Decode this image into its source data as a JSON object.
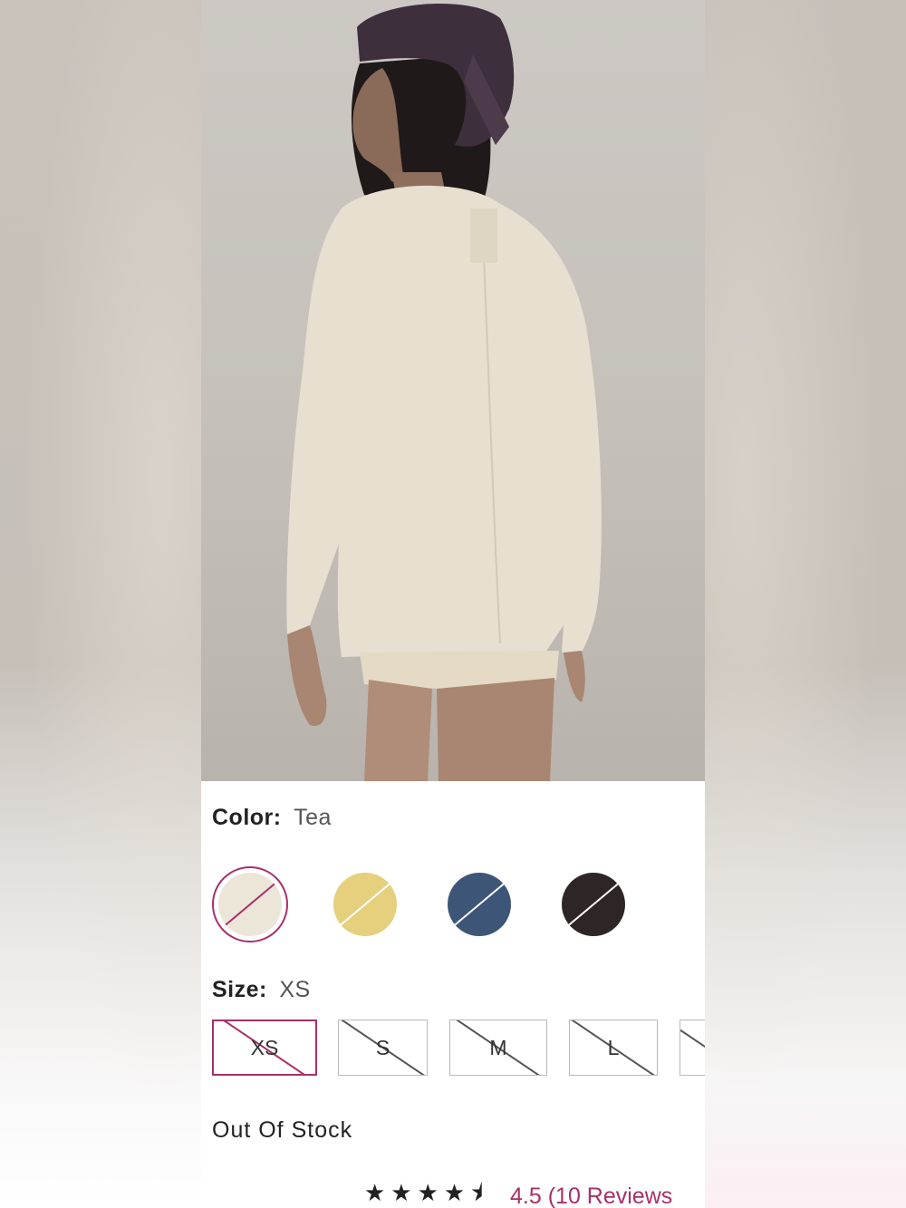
{
  "product": {
    "color": {
      "label": "Color:",
      "selected": "Tea",
      "swatches": [
        {
          "name": "tea",
          "hex": "#ece6d9",
          "selected": true,
          "available": false
        },
        {
          "name": "yellow",
          "hex": "#e6d07e",
          "selected": false,
          "available": false
        },
        {
          "name": "navy",
          "hex": "#3d5677",
          "selected": false,
          "available": false
        },
        {
          "name": "black",
          "hex": "#2e2626",
          "selected": false,
          "available": false
        }
      ]
    },
    "size": {
      "label": "Size:",
      "selected": "XS",
      "options": [
        "XS",
        "S",
        "M",
        "L",
        ""
      ]
    },
    "stock_status": "Out Of Stock",
    "rating": {
      "stars_glyph": "★★★★⯨",
      "value": 4.5,
      "text": "4.5 (10 Reviews"
    }
  },
  "colors": {
    "accent": "#a7306a",
    "text": "#222222",
    "muted": "#555555",
    "border": "#b9b9b9"
  }
}
